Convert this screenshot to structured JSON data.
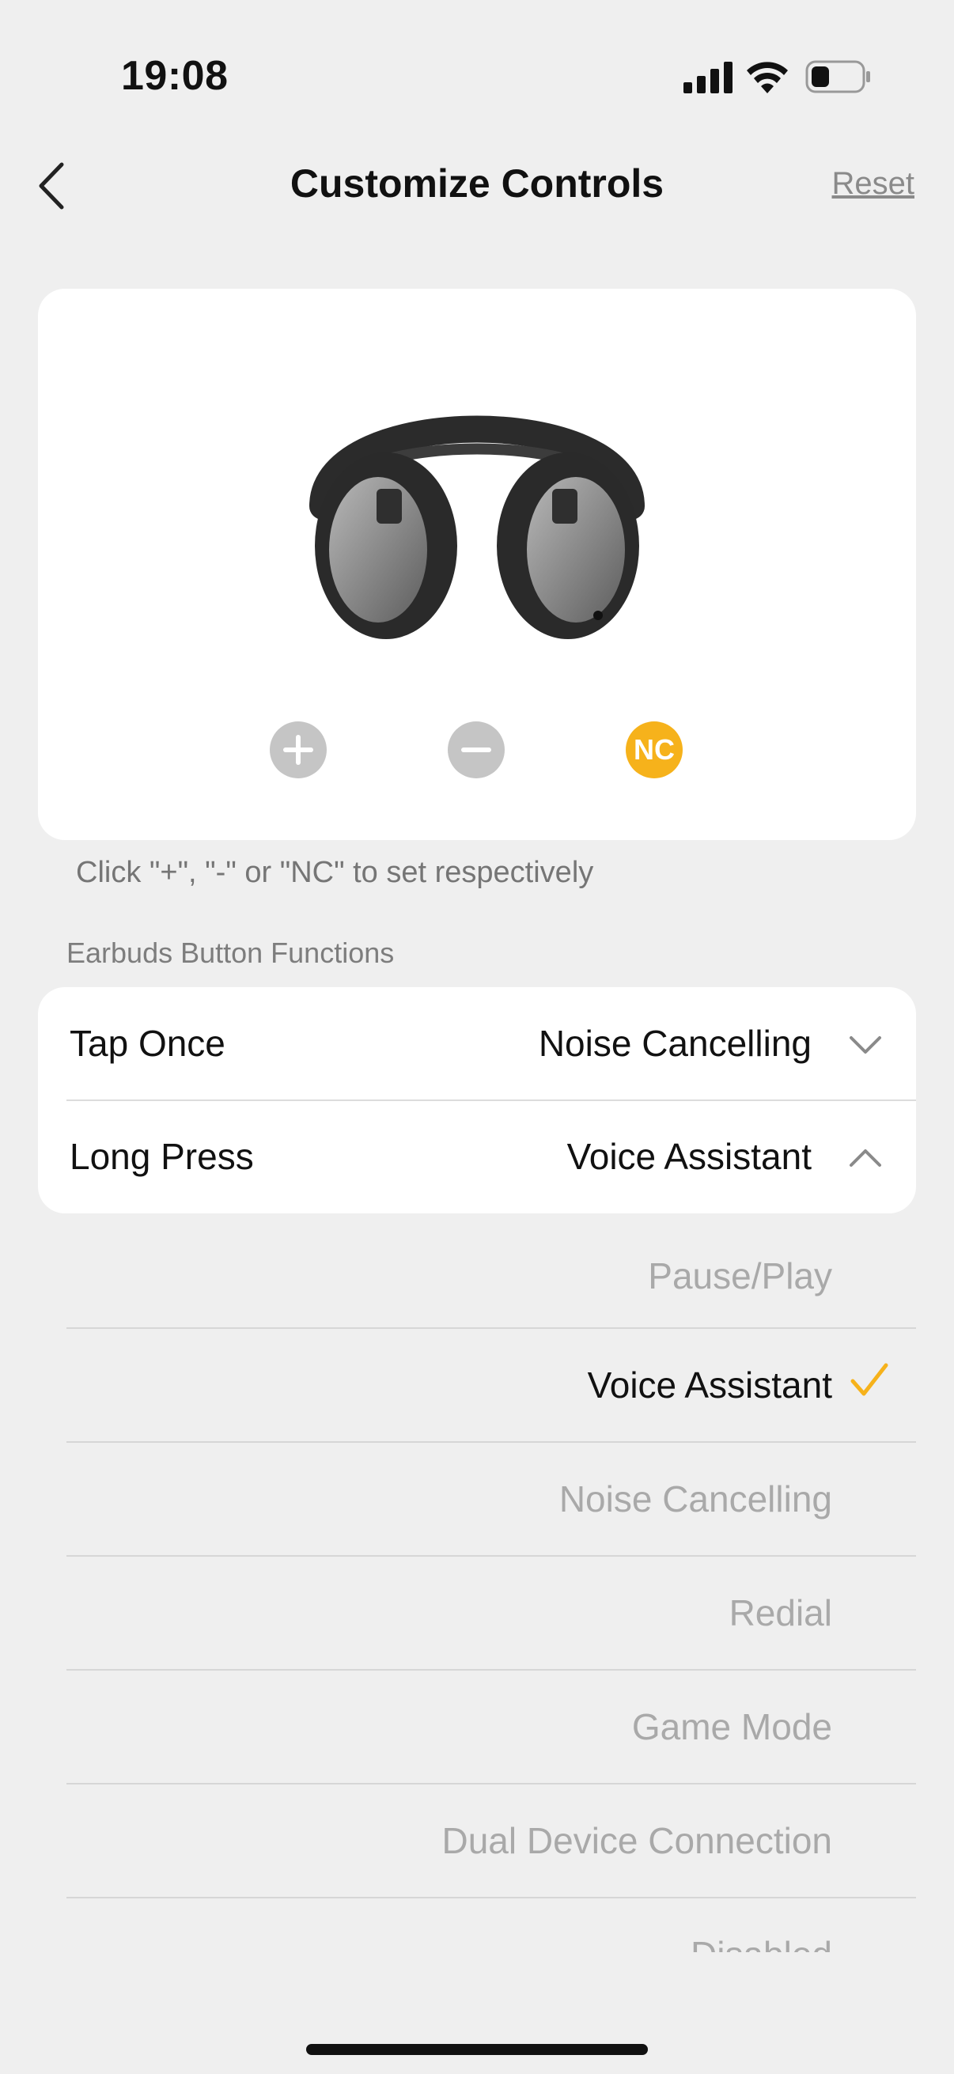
{
  "status_bar": {
    "time": "19:08"
  },
  "header": {
    "title": "Customize Controls",
    "reset_label": "Reset"
  },
  "controls": {
    "plus_label": "+",
    "minus_label": "−",
    "nc_label": "NC"
  },
  "hint": "Click \"+\", \"-\" or \"NC\" to set respectively",
  "section_label": "Earbuds Button Functions",
  "functions": [
    {
      "label": "Tap Once",
      "value": "Noise Cancelling"
    },
    {
      "label": "Long Press",
      "value": "Voice Assistant"
    }
  ],
  "options": [
    {
      "label": "Pause/Play"
    },
    {
      "label": "Voice Assistant"
    },
    {
      "label": "Noise Cancelling"
    },
    {
      "label": "Redial"
    },
    {
      "label": "Game Mode"
    },
    {
      "label": "Dual Device Connection"
    },
    {
      "label": "Disabled"
    }
  ],
  "selected_option": "Voice Assistant",
  "colors": {
    "accent": "#f6b21b",
    "background": "#efefef",
    "muted_text": "#a9a9a9"
  }
}
